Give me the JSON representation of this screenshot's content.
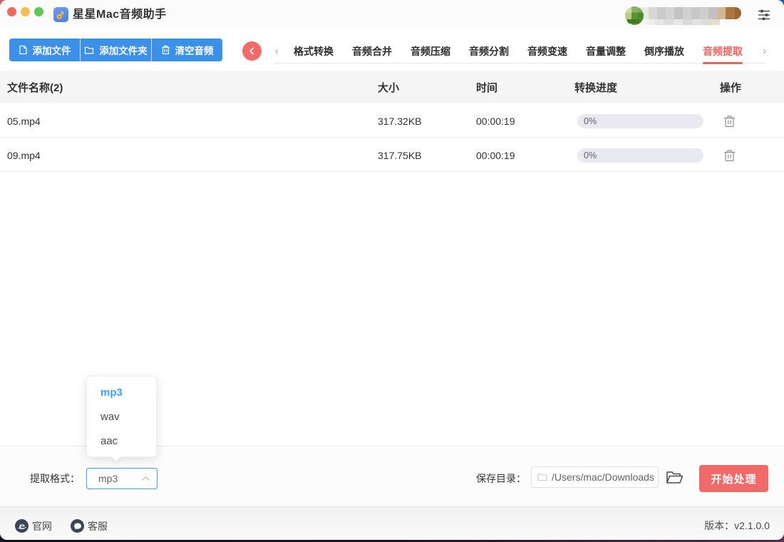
{
  "window": {
    "title": "星星Mac音频助手"
  },
  "toolbar": {
    "add_file": "添加文件",
    "add_folder": "添加文件夹",
    "clear_audio": "清空音频"
  },
  "tabs": {
    "items": [
      "格式转换",
      "音频合并",
      "音频压缩",
      "音频分割",
      "音频变速",
      "音量调整",
      "倒序播放",
      "音频提取"
    ],
    "active": "音频提取"
  },
  "table": {
    "headers": {
      "name": "文件名称(2)",
      "size": "大小",
      "time": "时间",
      "progress": "转换进度",
      "action": "操作"
    },
    "rows": [
      {
        "name": "05.mp4",
        "size": "317.32KB",
        "time": "00:00:19",
        "progress": "0%"
      },
      {
        "name": "09.mp4",
        "size": "317.75KB",
        "time": "00:00:19",
        "progress": "0%"
      }
    ]
  },
  "format_panel": {
    "label": "提取格式：",
    "selected": "mp3",
    "options": [
      "mp3",
      "wav",
      "aac"
    ]
  },
  "save_panel": {
    "label": "保存目录：",
    "path": "/Users/mac/Downloads",
    "start_button": "开始处理"
  },
  "footer": {
    "website": "官网",
    "support": "客服",
    "version": "版本：v2.1.0.0"
  },
  "colors": {
    "primary_blue": "#3d90e8",
    "accent_red": "#f15f5f",
    "select_border_blue": "#409eff"
  }
}
